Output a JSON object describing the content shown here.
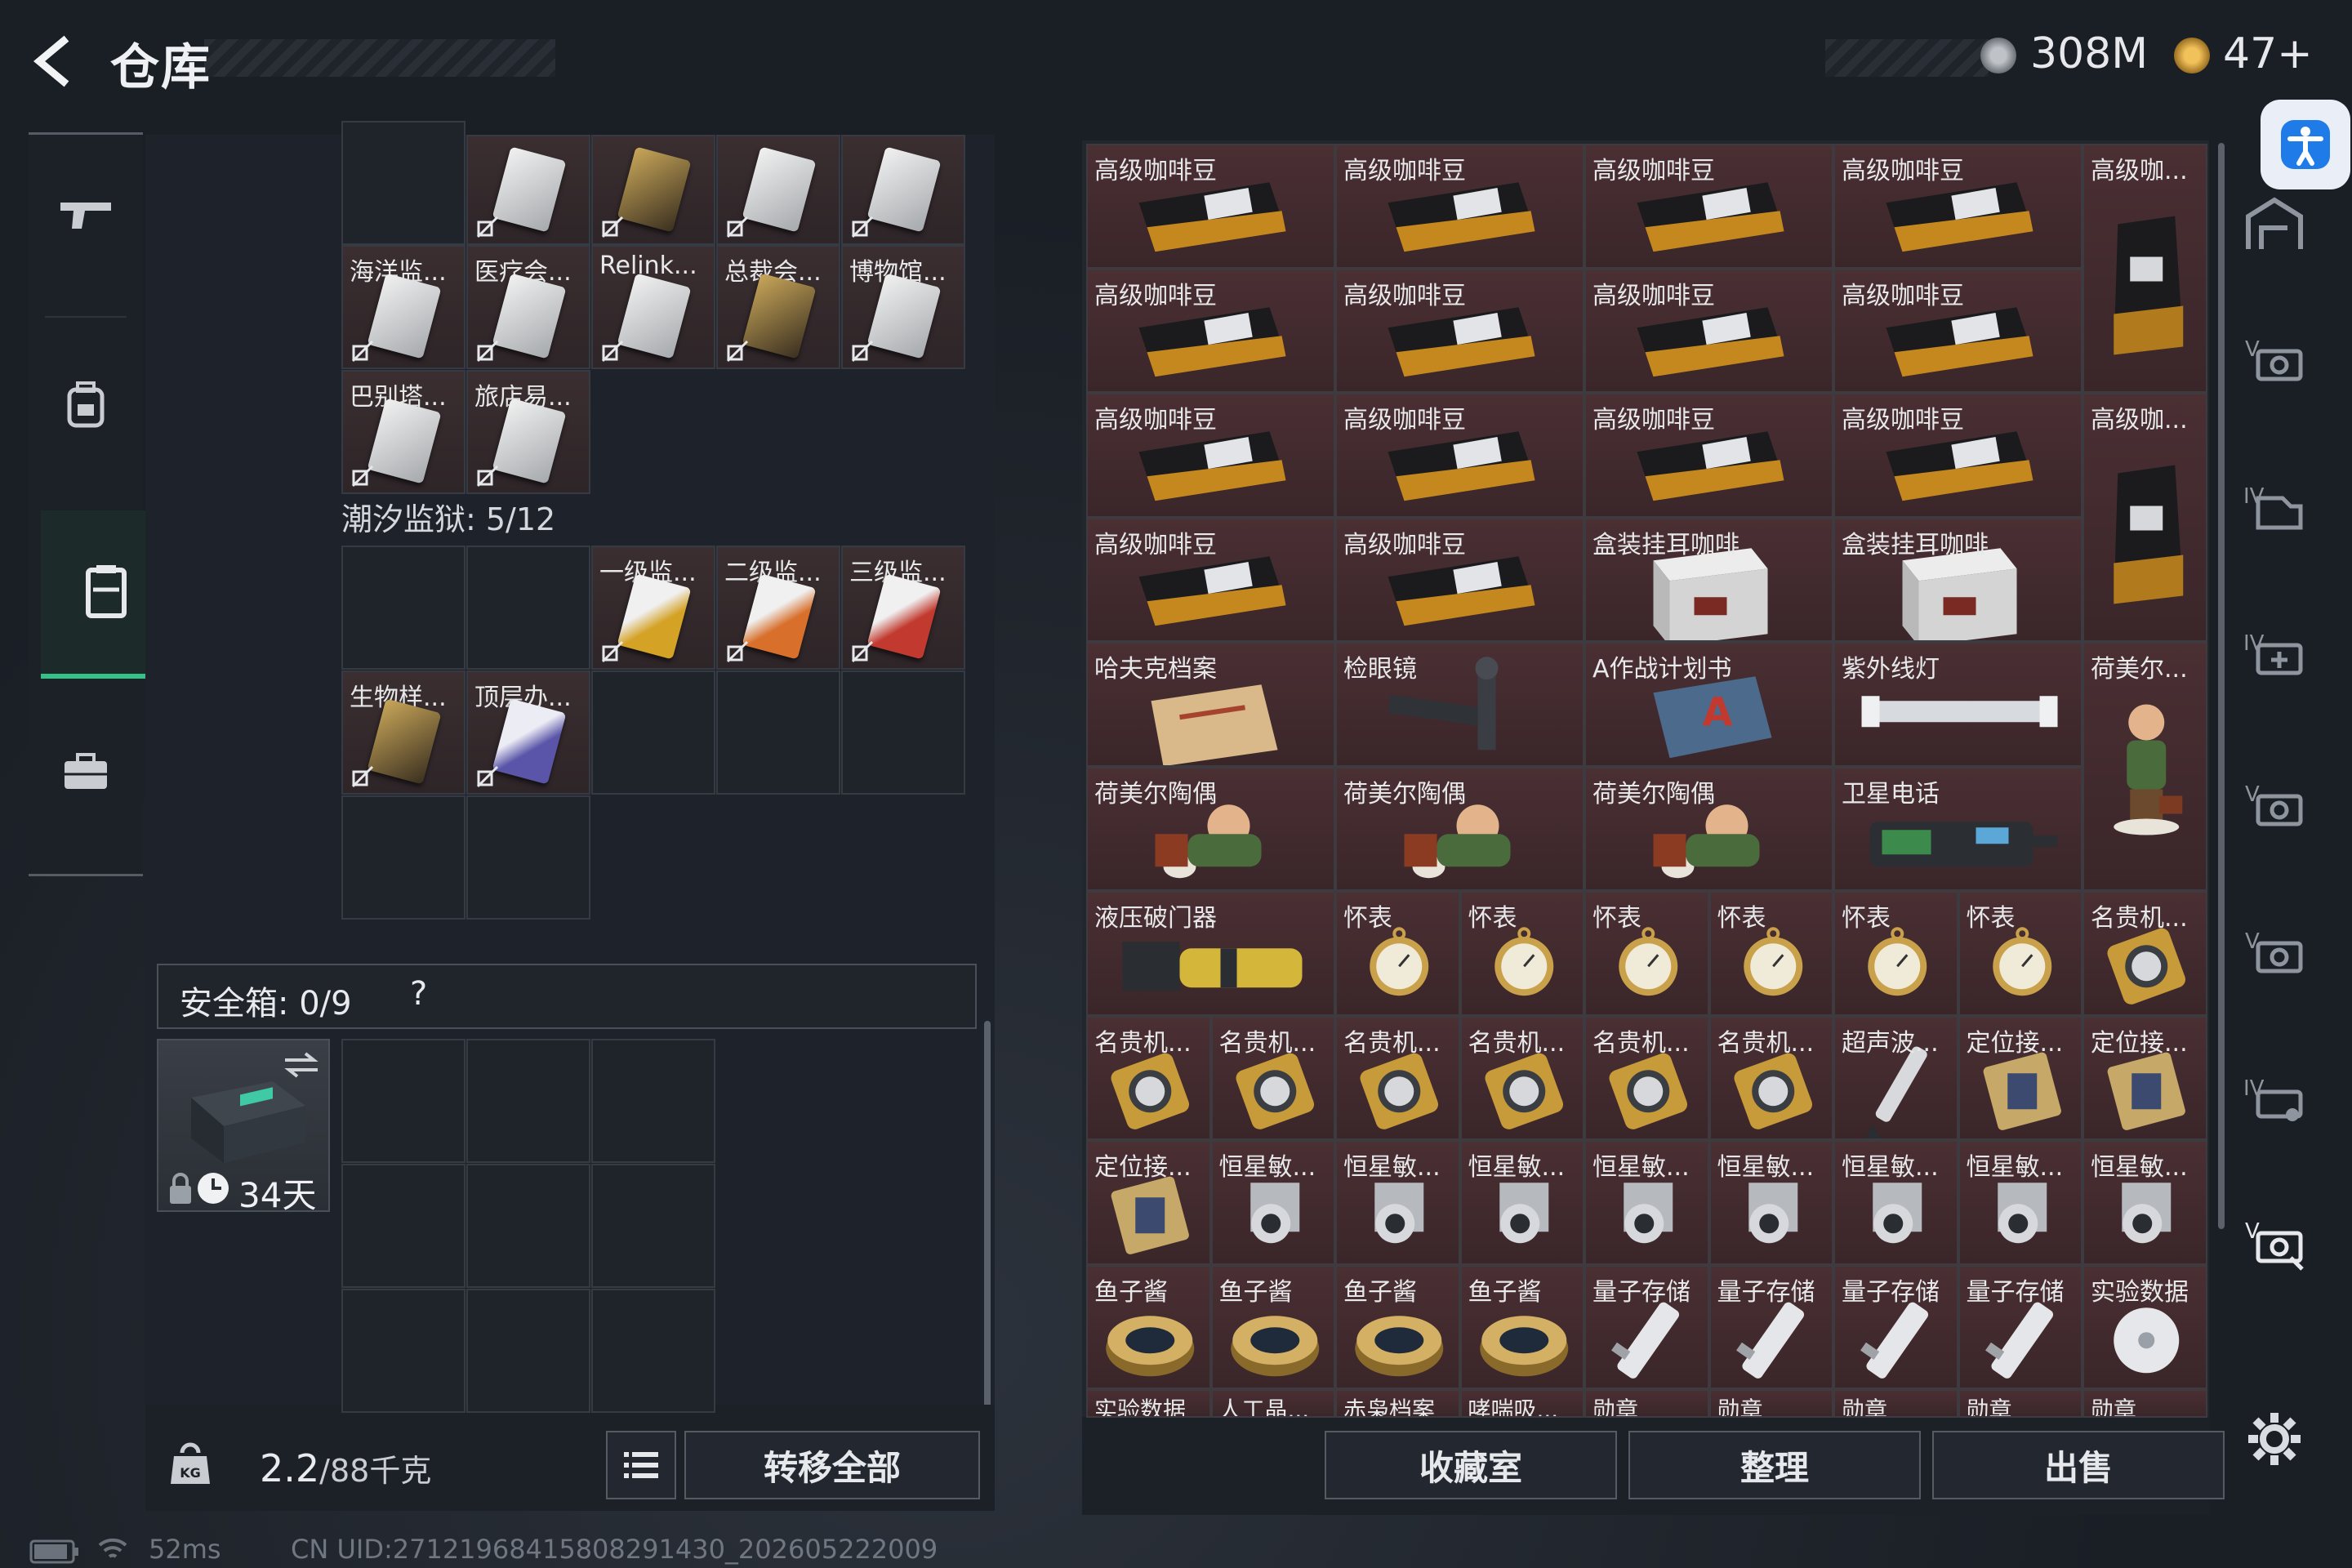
{
  "header": {
    "title": "仓库",
    "currency1": "308M",
    "currency2": "47+"
  },
  "nav": {
    "items": [
      "gun-icon",
      "backpack-icon",
      "chest-rig-icon",
      "briefcase-icon"
    ],
    "active_index": 2
  },
  "cards_top": [
    {
      "label": "",
      "style": "white"
    },
    {
      "label": "",
      "style": "white"
    },
    {
      "label": "",
      "style": "gold"
    },
    {
      "label": "",
      "style": "white"
    },
    {
      "label": "",
      "style": "white"
    },
    {
      "label": "海洋监...",
      "style": "white"
    },
    {
      "label": "医疗会...",
      "style": "white"
    },
    {
      "label": "Relink...",
      "style": "white"
    },
    {
      "label": "总裁会...",
      "style": "gold"
    },
    {
      "label": "博物馆...",
      "style": "white"
    },
    {
      "label": "巴别塔...",
      "style": "white"
    },
    {
      "label": "旅店易...",
      "style": "white"
    }
  ],
  "section_tidal": {
    "title": "潮汐监狱: 5/12"
  },
  "cards_tidal": [
    {
      "label": "一级监...",
      "style": "yellow"
    },
    {
      "label": "二级监...",
      "style": "orange"
    },
    {
      "label": "三级监...",
      "style": "red"
    },
    {
      "label": "生物样...",
      "style": "gold"
    },
    {
      "label": "顶层办...",
      "style": "purple"
    }
  ],
  "safe": {
    "label": "安全箱: 0/9",
    "help": "?",
    "timer": "34天"
  },
  "weight": {
    "value": "2.2",
    "max": "/88千克"
  },
  "buttons": {
    "transfer_all": "转移全部",
    "collection": "收藏室",
    "organize": "整理",
    "sell": "出售"
  },
  "items": {
    "coffee": "高级咖啡豆",
    "coffee_short": "高级咖...",
    "boxed_coffee": "盒装挂耳咖啡",
    "hafk": "哈夫克档案",
    "scope": "检眼镜",
    "plan_a": "A作战计划书",
    "uv": "紫外线灯",
    "hummel_short": "荷美尔...",
    "hummel": "荷美尔陶偶",
    "satphone": "卫星电话",
    "breacher": "液压破门器",
    "watch": "怀表",
    "luxwatch": "名贵机...",
    "ultrasonic": "超声波...",
    "locator": "定位接...",
    "star": "恒星敏...",
    "caviar": "鱼子酱",
    "quantum": "量子存储",
    "labdata": "实验数据",
    "row_bottom": [
      "实验数据",
      "人工晶...",
      "赤枭档案",
      "哮喘吸...",
      "勋章",
      "勋章",
      "勋章",
      "勋章",
      "勋章"
    ]
  },
  "footer": {
    "ping": "52ms",
    "uid": "CN UID:27121968415808291430_202605222009"
  }
}
